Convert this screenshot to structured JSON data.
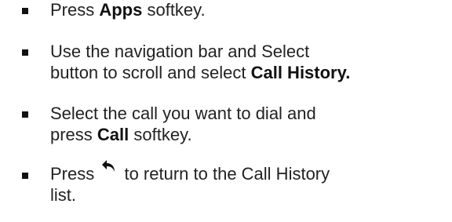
{
  "steps": [
    {
      "parts": {
        "a": "Press ",
        "b": "Apps",
        "c": " softkey."
      }
    },
    {
      "line1": "Use the navigation bar and Select",
      "line2_a": "button to scroll and select ",
      "line2_b": "Call History."
    },
    {
      "line1": "Select the call you want to dial and",
      "line2_a": "press ",
      "line2_b": "Call",
      "line2_c": " softkey."
    },
    {
      "line1_a": "Press ",
      "icon": "back-arrow-icon",
      "line1_b": " to return to the Call History",
      "line2": "list."
    }
  ]
}
